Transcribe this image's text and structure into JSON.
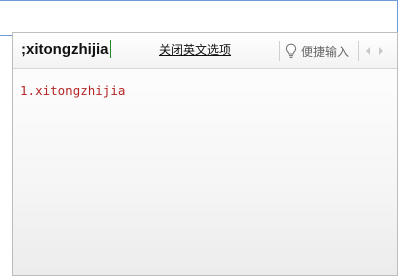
{
  "composition": {
    "text": ";xitongzhijia"
  },
  "toolbar": {
    "close_english_label": "关闭英文选项",
    "quick_input_label": "便捷输入",
    "quick_input_icon": "lightbulb-icon",
    "prev_icon": "arrow-left-icon",
    "next_icon": "arrow-right-icon"
  },
  "candidates": [
    {
      "index": "1.",
      "text": "xitongzhijia"
    }
  ],
  "colors": {
    "candidate": "#b52525",
    "caret": "#1e8a2b",
    "host_border": "#6f9bd8",
    "panel_border": "#bdbdbd"
  }
}
